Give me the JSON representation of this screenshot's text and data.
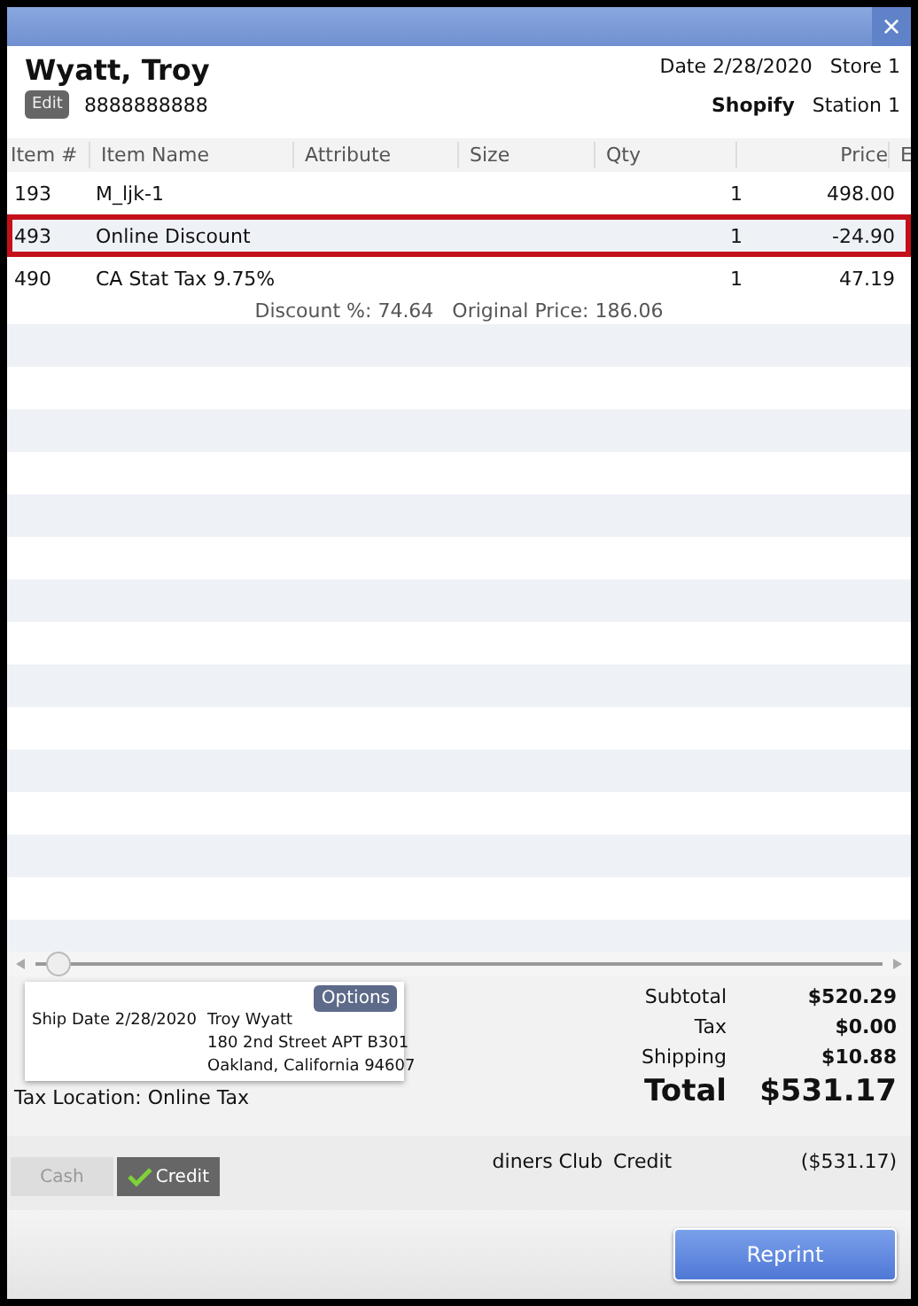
{
  "window": {
    "close": "×"
  },
  "customer": {
    "name": "Wyatt, Troy",
    "edit_button": "Edit",
    "phone": "8888888888"
  },
  "header": {
    "date": "Date 2/28/2020",
    "store": "Store 1",
    "channel": "Shopify",
    "station": "Station 1"
  },
  "table": {
    "columns": [
      "Item #",
      "Item Name",
      "Attribute",
      "Size",
      "Qty",
      "Price",
      "E"
    ],
    "rows": [
      {
        "item": "193",
        "name": "M_ljk-1",
        "qty": "1",
        "price": "498.00",
        "selected": false
      },
      {
        "item": "493",
        "name": "Online Discount",
        "qty": "1",
        "price": "-24.90",
        "selected": true
      },
      {
        "item": "490",
        "name": "CA Stat Tax 9.75%",
        "qty": "1",
        "price": "47.19",
        "selected": false
      }
    ],
    "note": "Discount %: 74.64   Original Price: 186.06"
  },
  "shipping": {
    "options_button": "Options",
    "label": "Ship Date 2/28/2020",
    "lines": [
      "Troy Wyatt",
      "180 2nd Street APT B301",
      "Oakland, California 94607"
    ]
  },
  "tax_location": "Tax Location: Online Tax",
  "totals": [
    {
      "label": "Subtotal",
      "value": "$520.29",
      "kind": "normal"
    },
    {
      "label": "Tax",
      "value": "$0.00",
      "kind": "normal"
    },
    {
      "label": "Shipping",
      "value": "$10.88",
      "kind": "normal"
    },
    {
      "label": "Total",
      "value": "$531.17",
      "kind": "grand"
    }
  ],
  "payment_buttons": [
    {
      "label": "Cash",
      "selected": false
    },
    {
      "label": "Credit",
      "selected": true
    }
  ],
  "payment": {
    "card": "diners Club",
    "type": "Credit",
    "amount": "($531.17)"
  },
  "reprint_button": "Reprint"
}
